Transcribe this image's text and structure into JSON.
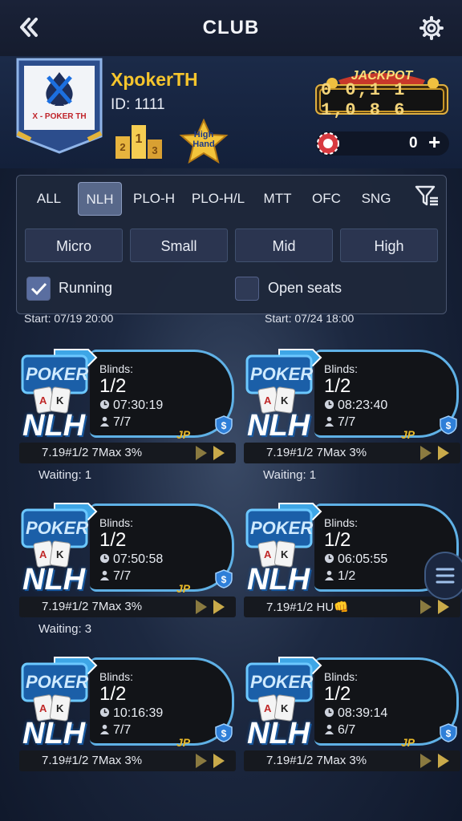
{
  "topbar": {
    "title": "CLUB",
    "back_icon": "double-chevron-left-icon",
    "settings_icon": "gear-icon"
  },
  "club": {
    "name": "XpokerTH",
    "id_text": "ID: 1111",
    "badge_text": "X - POKER TH",
    "highhand_text": "High Hand"
  },
  "jackpot": {
    "label": "JACKPOT",
    "digits": "0 0,1 1 1,0 8 6"
  },
  "chips": {
    "value": "0",
    "plus": "+"
  },
  "filters": {
    "tabs": [
      "ALL",
      "NLH",
      "PLO-H",
      "PLO-H/L",
      "MTT",
      "OFC",
      "SNG"
    ],
    "active_tab": "NLH",
    "levels": [
      "Micro",
      "Small",
      "Mid",
      "High"
    ],
    "running_label": "Running",
    "running_checked": true,
    "open_seats_label": "Open seats",
    "open_seats_checked": false
  },
  "start_times": [
    "Start: 07/19 20:00",
    "Start: 07/24 18:00"
  ],
  "tables": [
    {
      "blinds_label": "Blinds:",
      "blinds": "1/2",
      "time": "07:30:19",
      "seats": "7/7",
      "desc": "7.19#1/2  7Max 3%",
      "waiting": "Waiting: 1",
      "jp": "JP",
      "game": "NLH",
      "logo": "POKER"
    },
    {
      "blinds_label": "Blinds:",
      "blinds": "1/2",
      "time": "08:23:40",
      "seats": "7/7",
      "desc": "7.19#1/2  7Max 3%",
      "waiting": "Waiting: 1",
      "jp": "JP",
      "game": "NLH",
      "logo": "POKER"
    },
    {
      "blinds_label": "Blinds:",
      "blinds": "1/2",
      "time": "07:50:58",
      "seats": "7/7",
      "desc": "7.19#1/2  7Max 3%",
      "waiting": "Waiting: 3",
      "jp": "JP",
      "game": "NLH",
      "logo": "POKER"
    },
    {
      "blinds_label": "Blinds:",
      "blinds": "1/2",
      "time": "06:05:55",
      "seats": "1/2",
      "desc": "7.19#1/2 HU👊",
      "waiting": "",
      "jp": "",
      "game": "NLH",
      "logo": "POKER"
    },
    {
      "blinds_label": "Blinds:",
      "blinds": "1/2",
      "time": "10:16:39",
      "seats": "7/7",
      "desc": "7.19#1/2  7Max 3%",
      "waiting": "",
      "jp": "JP",
      "game": "NLH",
      "logo": "POKER"
    },
    {
      "blinds_label": "Blinds:",
      "blinds": "1/2",
      "time": "08:39:14",
      "seats": "6/7",
      "desc": "7.19#1/2  7Max 3%",
      "waiting": "",
      "jp": "JP",
      "game": "NLH",
      "logo": "POKER"
    }
  ]
}
